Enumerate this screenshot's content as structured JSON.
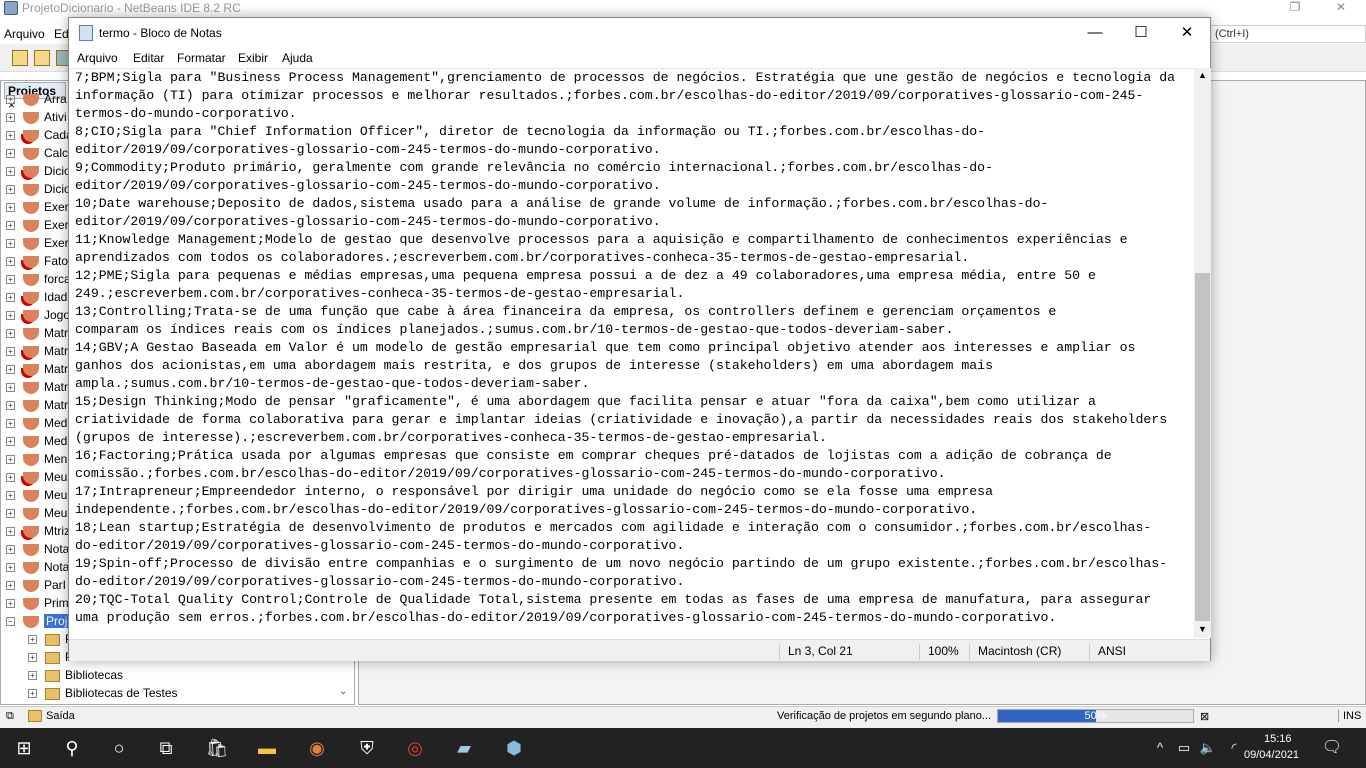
{
  "netbeans": {
    "title": "ProjetoDicionario - NetBeans IDE 8.2 RC",
    "menu": [
      "Arquivo",
      "Ed"
    ],
    "search_placeholder": "(Ctrl+I)",
    "projects_tab": "Projetos",
    "projects": [
      {
        "name": "Arra",
        "err": false
      },
      {
        "name": "Ativi",
        "err": false
      },
      {
        "name": "Cada",
        "err": true
      },
      {
        "name": "Calc",
        "err": false
      },
      {
        "name": "Dicio",
        "err": true
      },
      {
        "name": "Dicio",
        "err": false
      },
      {
        "name": "Exer",
        "err": false
      },
      {
        "name": "Exer",
        "err": false
      },
      {
        "name": "Exer",
        "err": false
      },
      {
        "name": "Fato",
        "err": true
      },
      {
        "name": "forca",
        "err": false
      },
      {
        "name": "Idad",
        "err": true
      },
      {
        "name": "Jogo",
        "err": true
      },
      {
        "name": "Matr",
        "err": false
      },
      {
        "name": "Matr",
        "err": true
      },
      {
        "name": "Matr",
        "err": true
      },
      {
        "name": "Matr",
        "err": false
      },
      {
        "name": "Matr",
        "err": false
      },
      {
        "name": "Medi",
        "err": false
      },
      {
        "name": "Medi",
        "err": false
      },
      {
        "name": "Menu",
        "err": false
      },
      {
        "name": "Meul",
        "err": true
      },
      {
        "name": "Meul",
        "err": false
      },
      {
        "name": "Meul",
        "err": false
      },
      {
        "name": "Mtriz",
        "err": true
      },
      {
        "name": "Nota",
        "err": false
      },
      {
        "name": "Nota",
        "err": false
      },
      {
        "name": "ParI",
        "err": false
      },
      {
        "name": "Prim",
        "err": false
      },
      {
        "name": "Proj",
        "err": false,
        "selected": true
      }
    ],
    "children": [
      "P",
      "Pacotes de Teste",
      "Bibliotecas",
      "Bibliotecas de Testes"
    ],
    "output_tab": "Saída",
    "status_text": "Verificação de projetos em segundo plano...",
    "progress_percent": 50,
    "progress_label": "50%",
    "insert_mode": "INS"
  },
  "notepad": {
    "title": "termo - Bloco de Notas",
    "menu": [
      "Arquivo",
      "Editar",
      "Formatar",
      "Exibir",
      "Ajuda"
    ],
    "lines": [
      "7;BPM;Sigla para \"Business Process Management\",grenciamento de processos de negócios. Estratégia que une gestão de negócios e tecnologia da",
      "informação (TI) para otimizar processos e melhorar resultados.;forbes.com.br/escolhas-do-editor/2019/09/corporatives-glossario-com-245-",
      "termos-do-mundo-corporativo.",
      "8;CIO;Sigla para \"Chief Information Officer\", diretor de tecnologia da informação ou TI.;forbes.com.br/escolhas-do-",
      "editor/2019/09/corporatives-glossario-com-245-termos-do-mundo-corporativo.",
      "9;Commodity;Produto primário, geralmente com grande relevância no comércio internacional.;forbes.com.br/escolhas-do-",
      "editor/2019/09/corporatives-glossario-com-245-termos-do-mundo-corporativo.",
      "10;Date warehouse;Deposito de dados,sistema usado para a análise de grande volume de informação.;forbes.com.br/escolhas-do-",
      "editor/2019/09/corporatives-glossario-com-245-termos-do-mundo-corporativo.",
      "11;Knowledge Management;Modelo de gestao que desenvolve processos para a aquisição e compartilhamento de conhecimentos experiências e",
      "aprendizados com todos os colaboradores.;escreverbem.com.br/corporatives-conheca-35-termos-de-gestao-empresarial.",
      "12;PME;Sigla para pequenas e médias empresas,uma pequena empresa possui a de dez a 49 colaboradores,uma empresa média, entre 50 e",
      "249.;escreverbem.com.br/corporatives-conheca-35-termos-de-gestao-empresarial.",
      "13;Controlling;Trata-se de uma função que cabe à área financeira da empresa, os controllers definem e gerenciam orçamentos e",
      "comparam os índices reais com os índices planejados.;sumus.com.br/10-termos-de-gestao-que-todos-deveriam-saber.",
      "14;GBV;A Gestao Baseada em Valor é um modelo de gestão empresarial que tem como principal objetivo atender aos interesses e ampliar os",
      "ganhos dos acionistas,em uma abordagem mais restrita, e dos grupos de interesse (stakeholders) em uma abordagem mais",
      "ampla.;sumus.com.br/10-termos-de-gestao-que-todos-deveriam-saber.",
      "15;Design Thinking;Modo de pensar \"graficamente\", é uma abordagem que facilita pensar e atuar \"fora da caixa\",bem como utilizar a",
      "criatividade de forma colaborativa para gerar e implantar ideias (criatividade e inovação),a partir da necessidades reais dos stakeholders",
      "(grupos de interesse).;escreverbem.com.br/corporatives-conheca-35-termos-de-gestao-empresarial.",
      "16;Factoring;Prática usada por algumas empresas que consiste em comprar cheques pré-datados de lojistas com a adição de cobrança de",
      "comissão.;forbes.com.br/escolhas-do-editor/2019/09/corporatives-glossario-com-245-termos-do-mundo-corporativo.",
      "17;Intrapreneur;Empreendedor interno, o responsável por dirigir uma unidade do negócio como se ela fosse uma empresa",
      "independente.;forbes.com.br/escolhas-do-editor/2019/09/corporatives-glossario-com-245-termos-do-mundo-corporativo.",
      "18;Lean startup;Estratégia de desenvolvimento de produtos e mercados com agilidade e interação com o consumidor.;forbes.com.br/escolhas-",
      "do-editor/2019/09/corporatives-glossario-com-245-termos-do-mundo-corporativo.",
      "19;Spin-off;Processo de divisão entre companhias e o surgimento de um novo negócio partindo de um grupo existente.;forbes.com.br/escolhas-",
      "do-editor/2019/09/corporatives-glossario-com-245-termos-do-mundo-corporativo.",
      "20;TQC-Total Quality Control;Controle de Qualidade Total,sistema presente em todas as fases de uma empresa de manufatura, para assegurar",
      "uma produção sem erros.;forbes.com.br/escolhas-do-editor/2019/09/corporatives-glossario-com-245-termos-do-mundo-corporativo."
    ],
    "status": {
      "position": "Ln 3, Col 21",
      "zoom": "100%",
      "eol": "Macintosh (CR)",
      "encoding": "ANSI"
    }
  },
  "taskbar": {
    "time": "15:16",
    "date": "09/04/2021"
  }
}
